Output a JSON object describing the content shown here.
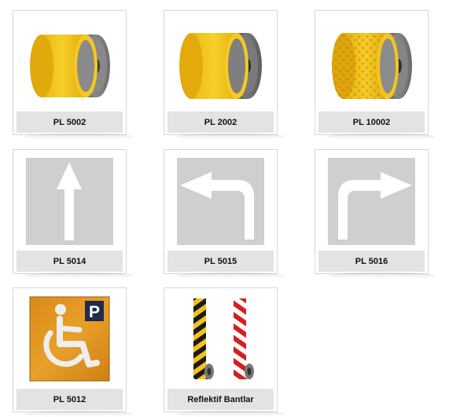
{
  "products": [
    {
      "label": "PL 5002",
      "image": "yellow-tape-roll"
    },
    {
      "label": "PL 2002",
      "image": "yellow-tape-roll"
    },
    {
      "label": "PL 10002",
      "image": "textured-yellow-tape-roll"
    },
    {
      "label": "PL 5014",
      "image": "straight-arrow-marking"
    },
    {
      "label": "PL 5015",
      "image": "left-turn-arrow-marking"
    },
    {
      "label": "PL 5016",
      "image": "right-turn-arrow-marking"
    },
    {
      "label": "PL 5012",
      "image": "disabled-parking-marking",
      "sign_letter": "P"
    },
    {
      "label": "Reflektif Bantlar",
      "image": "reflective-warning-tapes"
    }
  ],
  "colors": {
    "tape_yellow": "#f2c21a",
    "sign_gray": "#cfcfcf",
    "parking_orange": "#e0941c",
    "parking_p_bg": "#232a4a",
    "stripe_black": "#1a1a1a",
    "stripe_red": "#d42020"
  }
}
